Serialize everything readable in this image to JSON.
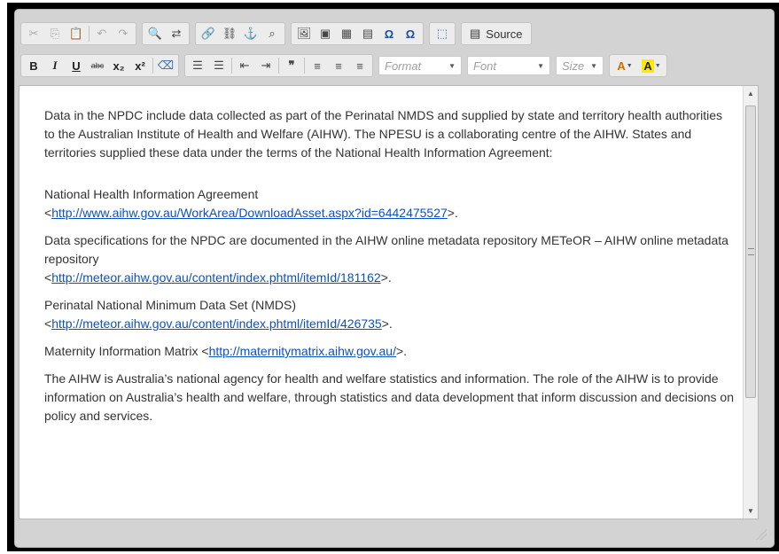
{
  "toolbar": {
    "row1": {
      "clipboard": [
        {
          "name": "cut-icon",
          "glyph": "✂",
          "disabled": true
        },
        {
          "name": "copy-icon",
          "glyph": "⎘",
          "disabled": true
        },
        {
          "name": "paste-icon",
          "glyph": "📋",
          "disabled": false
        }
      ],
      "history": [
        {
          "name": "undo-icon",
          "glyph": "↶",
          "disabled": true
        },
        {
          "name": "redo-icon",
          "glyph": "↷",
          "disabled": true
        }
      ],
      "find": [
        {
          "name": "find-icon",
          "glyph": "🔍"
        },
        {
          "name": "replace-icon",
          "glyph": "⇄"
        }
      ],
      "links": [
        {
          "name": "link-icon",
          "glyph": "🔗"
        },
        {
          "name": "unlink-icon",
          "glyph": "⛓"
        },
        {
          "name": "anchor-icon",
          "glyph": "⚓"
        },
        {
          "name": "zoom-icon",
          "glyph": "⌕"
        }
      ],
      "insert": [
        {
          "name": "image-icon",
          "glyph": "🖼"
        },
        {
          "name": "flash-icon",
          "glyph": "▣"
        },
        {
          "name": "table-icon",
          "glyph": "▦"
        },
        {
          "name": "horizontal-rule-icon",
          "glyph": "▤"
        },
        {
          "name": "special-char-icon",
          "glyph": "Ω"
        },
        {
          "name": "special-char-alt-icon",
          "glyph": "Ω"
        }
      ],
      "maximize": {
        "name": "maximize-icon",
        "glyph": "⬚"
      },
      "source_label": "Source"
    },
    "row2": {
      "styles": [
        {
          "name": "bold-icon",
          "glyph": "B"
        },
        {
          "name": "italic-icon",
          "glyph": "I"
        },
        {
          "name": "underline-icon",
          "glyph": "U"
        },
        {
          "name": "strikethrough-icon",
          "glyph": "abc"
        },
        {
          "name": "subscript-icon",
          "glyph": "x₂"
        },
        {
          "name": "superscript-icon",
          "glyph": "x²"
        },
        {
          "name": "remove-format-icon",
          "glyph": "⌫"
        }
      ],
      "lists": [
        {
          "name": "numbered-list-icon",
          "glyph": "☰"
        },
        {
          "name": "bulleted-list-icon",
          "glyph": "☰"
        },
        {
          "name": "outdent-icon",
          "glyph": "⇤"
        },
        {
          "name": "indent-icon",
          "glyph": "⇥"
        },
        {
          "name": "blockquote-icon",
          "glyph": "❞"
        }
      ],
      "align": [
        {
          "name": "align-left-icon",
          "glyph": "≡"
        },
        {
          "name": "align-center-icon",
          "glyph": "≡"
        },
        {
          "name": "align-right-icon",
          "glyph": "≡"
        }
      ],
      "format_label": "Format",
      "font_label": "Font",
      "size_label": "Size",
      "text_color_glyph": "A",
      "bg_color_glyph": "A"
    }
  },
  "document": {
    "p1": "Data in the NPDC include data collected as part of the Perinatal NMDS and supplied by state and territory health authorities to the Australian Institute of Health and Welfare (AIHW). The NPESU is a collaborating centre of the AIHW. States and territories supplied these data under the terms of the National Health Information Agreement:",
    "p2_text": "National Health Information Agreement",
    "p2_link": "http://www.aihw.gov.au/WorkArea/DownloadAsset.aspx?id=6442475527",
    "p3_text": "Data specifications for the NPDC are documented in the AIHW online metadata repository METeOR – AIHW online metadata repository",
    "p3_link": "http://meteor.aihw.gov.au/content/index.phtml/itemId/181162",
    "p4_text": "Perinatal National Minimum Data Set (NMDS)",
    "p4_link": "http://meteor.aihw.gov.au/content/index.phtml/itemId/426735",
    "p5_text": "Maternity Information Matrix ",
    "p5_link": "http://maternitymatrix.aihw.gov.au/",
    "p6": "The AIHW is Australia’s national agency for health and welfare statistics and information. The role of the AIHW is to provide information on Australia’s health and welfare, through statistics and data development that inform discussion and decisions on policy and services.",
    "lt": "<",
    "gt": ">."
  },
  "colors": {
    "link": "#0b50c8",
    "text": "#333333",
    "toolbar": "#d3d3d3"
  }
}
